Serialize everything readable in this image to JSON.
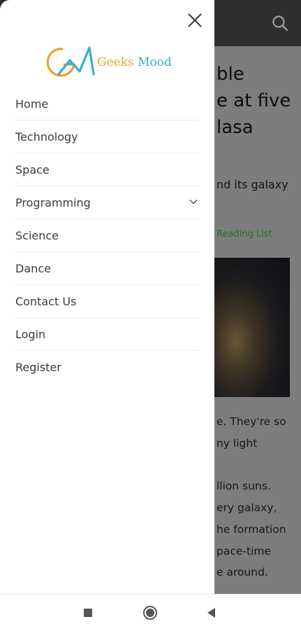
{
  "background": {
    "title_lines": [
      "ble",
      "e at five",
      "lasa"
    ],
    "subtitle": "nd its galaxy",
    "reading_list": "Reading List",
    "body_lines": [
      "e. They're so",
      "ny light",
      "llion suns.",
      "ery galaxy,",
      "he formation",
      "pace-time",
      "e around."
    ]
  },
  "drawer": {
    "logo_text_first": "Geeks",
    "logo_text_second": "Mood",
    "menu": [
      {
        "label": "Home"
      },
      {
        "label": "Technology"
      },
      {
        "label": "Space"
      },
      {
        "label": "Programming"
      },
      {
        "label": "Science"
      },
      {
        "label": "Dance"
      },
      {
        "label": "Contact Us"
      },
      {
        "label": "Login"
      },
      {
        "label": "Register"
      }
    ]
  },
  "colors": {
    "logo_orange": "#e9a52c",
    "logo_blue": "#3aaecd",
    "reading_green": "#2a6b29"
  },
  "icons": {
    "close": "close-icon",
    "search": "search-icon",
    "chevron": "chevron-down-icon",
    "recents": "recents-square-icon",
    "home": "home-circle-icon",
    "back": "back-triangle-icon"
  }
}
